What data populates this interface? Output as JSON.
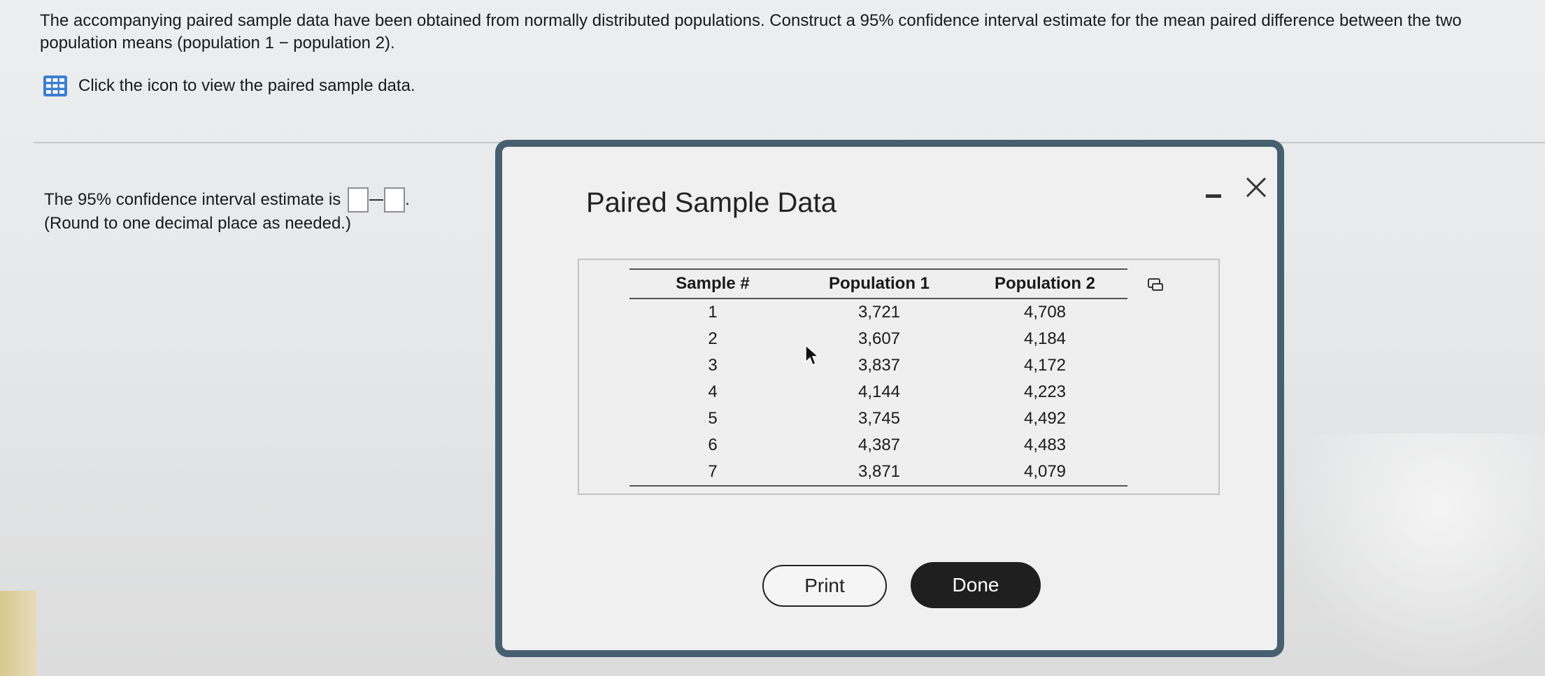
{
  "question": {
    "text": "The accompanying paired sample data have been obtained from normally distributed populations. Construct a 95% confidence interval estimate for the mean paired difference between the two population means (population 1 − population 2)."
  },
  "data_link": {
    "icon": "grid-icon",
    "label": "Click the icon to view the paired sample data."
  },
  "answer": {
    "prefix": "The 95% confidence interval estimate is",
    "lower_value": "",
    "upper_value": "",
    "suffix": ".",
    "note": "(Round to one decimal place as needed.)"
  },
  "modal": {
    "title": "Paired Sample Data",
    "minimize_icon": "minimize-icon",
    "close_icon": "close-icon",
    "columns": [
      "Sample #",
      "Population 1",
      "Population 2"
    ],
    "rows": [
      [
        "1",
        "3,721",
        "4,708"
      ],
      [
        "2",
        "3,607",
        "4,184"
      ],
      [
        "3",
        "3,837",
        "4,172"
      ],
      [
        "4",
        "4,144",
        "4,223"
      ],
      [
        "5",
        "3,745",
        "4,492"
      ],
      [
        "6",
        "4,387",
        "4,483"
      ],
      [
        "7",
        "3,871",
        "4,079"
      ]
    ],
    "print_label": "Print",
    "done_label": "Done"
  },
  "colors": {
    "modal_border": "#47606f",
    "icon_blue": "#3b7fd1",
    "done_button": "#1f1f1f"
  }
}
